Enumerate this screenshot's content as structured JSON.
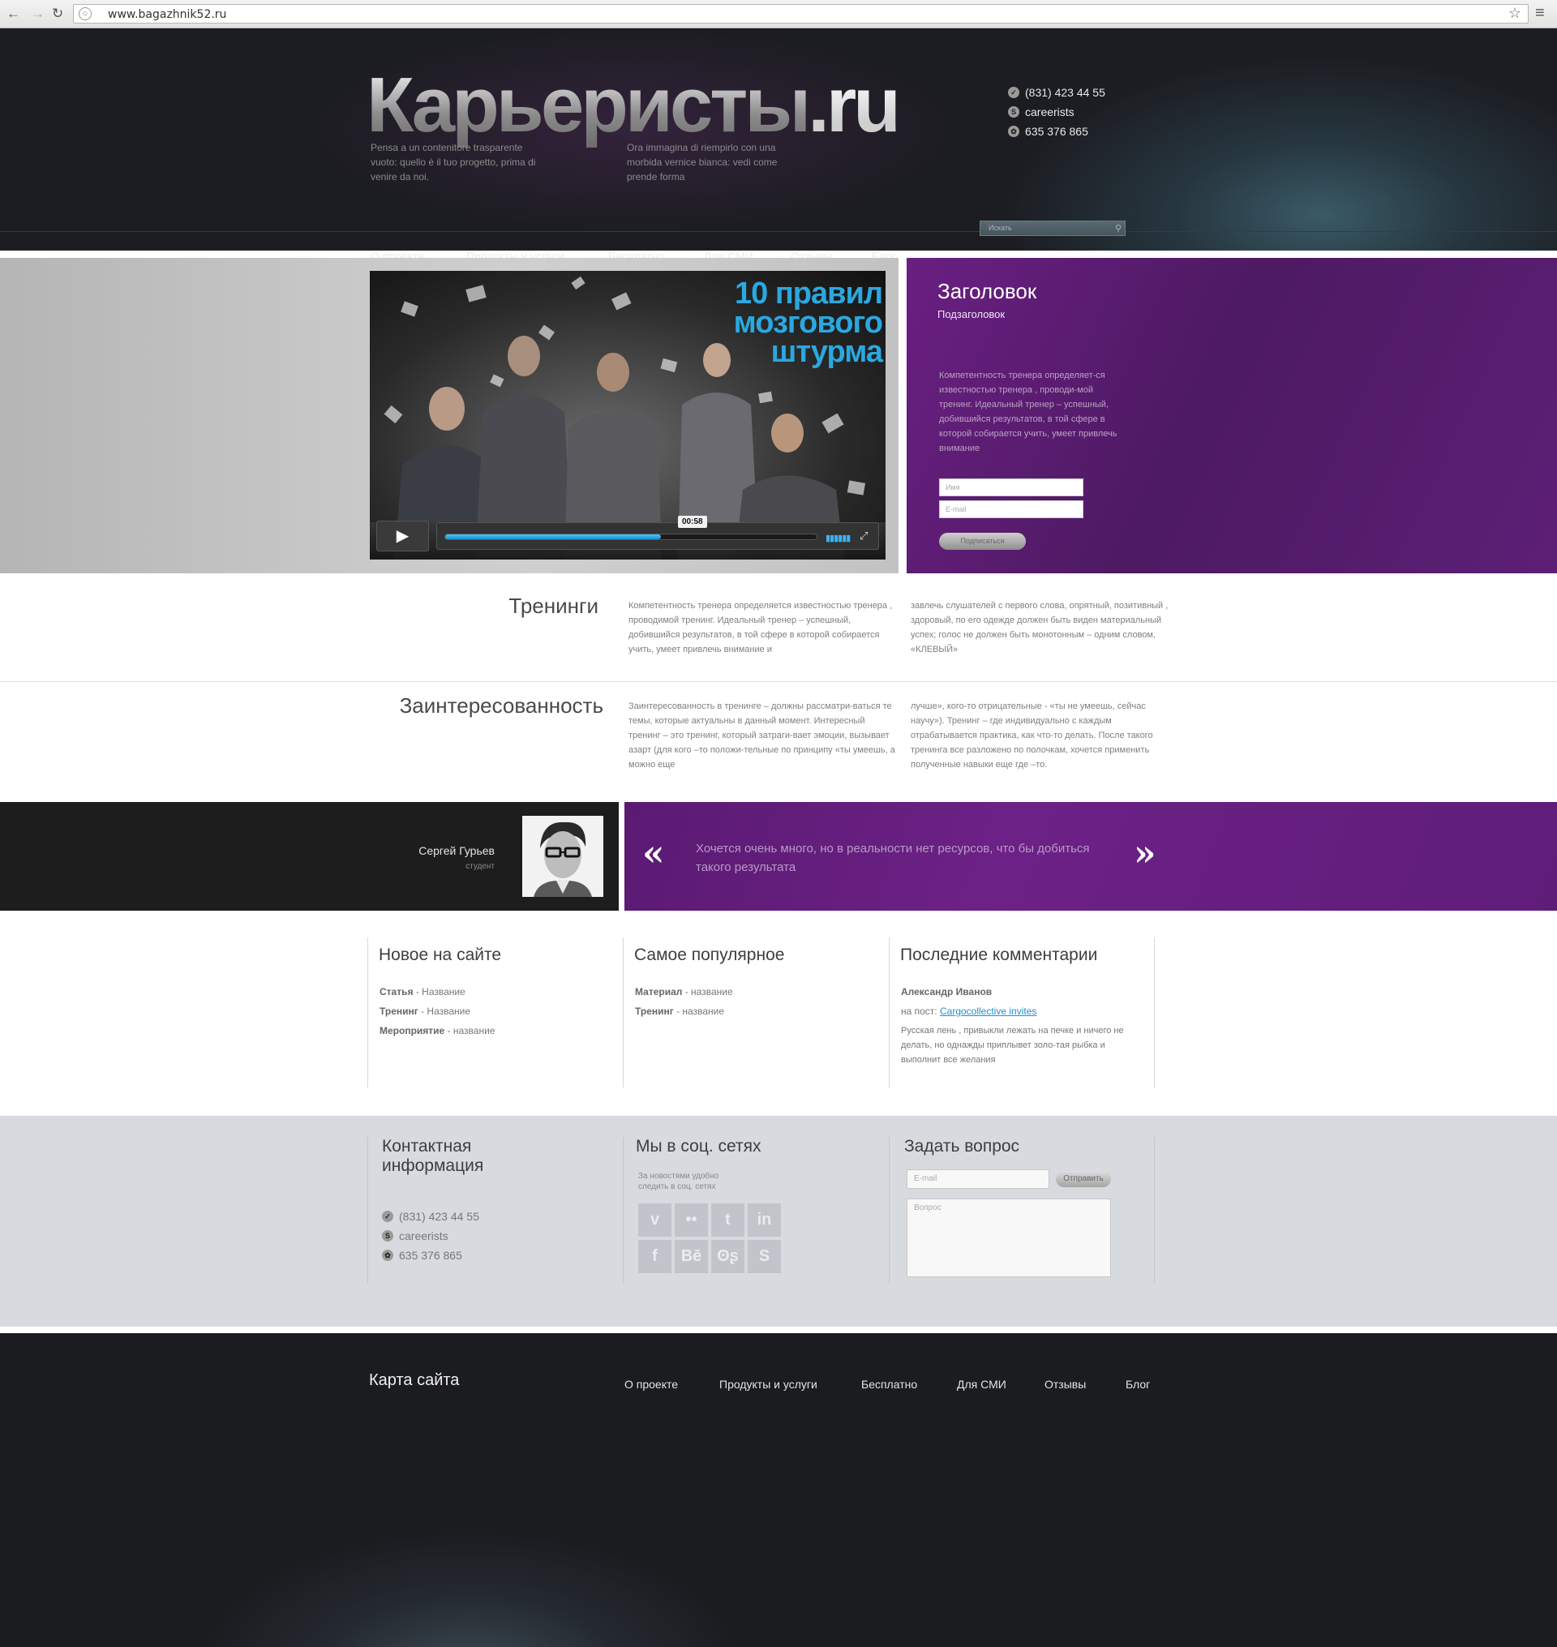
{
  "browser": {
    "url": "www.bagazhnik52.ru"
  },
  "header": {
    "logo_main": "Карьеристы",
    "logo_tld": ".ru",
    "tagline1": "Pensa a un contenitore trasparente vuoto: quello è il tuo progetto, prima di venire da noi.",
    "tagline2": "Ora immagina di riempirlo con una morbida vernice bianca: vedi come prende forma",
    "contacts": {
      "phone": "(831) 423 44 55",
      "skype": "careerists",
      "icq": "635 376 865"
    },
    "nav": [
      "О проекте",
      "Продукты и услуги",
      "Бесплатно",
      "Для СМИ",
      "Отзывы",
      "Блог"
    ],
    "search_placeholder": "Искать"
  },
  "hero": {
    "video_title": "10 правил мозгового штурма",
    "time": "00:58",
    "progress": 0.58,
    "title": "Заголовок",
    "subtitle": "Подзаголовок",
    "text": "Компетентность тренера определяет-ся известностью тренера , проводи-мой тренинг. Идеальный тренер – успешный, добившийся результатов, в той сфере в которой собирается учить, умеет привлечь внимание",
    "name_placeholder": "Имя",
    "email_placeholder": "E-mail",
    "subscribe_label": "Подписаться"
  },
  "trainings": {
    "title": "Тренинги",
    "col1": "Компетентность тренера определяется известностью тренера , проводимой тренинг. Идеальный тренер – успешный, добившийся результатов, в той сфере в которой собирается учить, умеет привлечь внимание и",
    "col2": "завлечь слушателей с первого слова, опрятный, позитивный , здоровый, по его одежде должен быть виден материальный успех; голос не должен быть монотонным – одним словом, «КЛЕВЫЙ»"
  },
  "interest": {
    "title": "Заинтересованность",
    "col1": "Заинтересованность в тренинге – должны рассматри-ваться те темы, которые актуальны в данный момент. Интересный тренинг – это тренинг, который затраги-вает эмоции, вызывает азарт (для кого –то положи-тельные по принципу «ты умеешь, а можно еще",
    "col2": "лучше», кого-то отрицательные - «ты не умеешь, сейчас научу»). Тренинг – где индивидуально с каждым отрабатывается практика, как что-то делать. После такого тренинга все разложено по полочкам, хочется применить полученные навыки еще где –то."
  },
  "testimonial": {
    "name": "Сергей Гурьев",
    "role": "студент",
    "quote": "Хочется очень много, но в реальности нет ресурсов, что бы добиться такого результата",
    "prev": "«",
    "next": "»"
  },
  "widgets": {
    "new": {
      "title": "Новое на сайте",
      "items": [
        {
          "type": "Статья",
          "name": " - Название"
        },
        {
          "type": "Тренинг",
          "name": " - Название"
        },
        {
          "type": "Мероприятие",
          "name": " - название"
        }
      ]
    },
    "popular": {
      "title": "Самое популярное",
      "items": [
        {
          "type": "Материал",
          "name": " - название"
        },
        {
          "type": "Тренинг",
          "name": " - название"
        }
      ]
    },
    "comments": {
      "title": "Последние комментарии",
      "author": "Александр Иванов",
      "post_prefix": "на пост: ",
      "post_link": "Cargocollective invites",
      "text": "Русская лень , привыкли лежать на печке и ничего не делать, но однажды приплывет золо-тая рыбка и выполнит все желания"
    }
  },
  "contact": {
    "title1": "Контактная",
    "title2": "информация",
    "phone": "(831) 423 44 55",
    "skype": "careerists",
    "icq": "635 376 865",
    "social_title": "Мы в соц. сетях",
    "social_text1": "За новостями удобно",
    "social_text2": "следить в соц. сетях",
    "social_icons": [
      "v",
      "••",
      "t",
      "in",
      "f",
      "Bē",
      "ʘʂ",
      "S"
    ],
    "ask_title": "Задать вопрос",
    "email_placeholder": "E-mail",
    "send_label": "Отправить",
    "question_placeholder": "Вопрос"
  },
  "footer": {
    "title": "Карта сайта",
    "nav": [
      "О проекте",
      "Продукты и услуги",
      "Бесплатно",
      "Для СМИ",
      "Отзывы",
      "Блог"
    ]
  }
}
